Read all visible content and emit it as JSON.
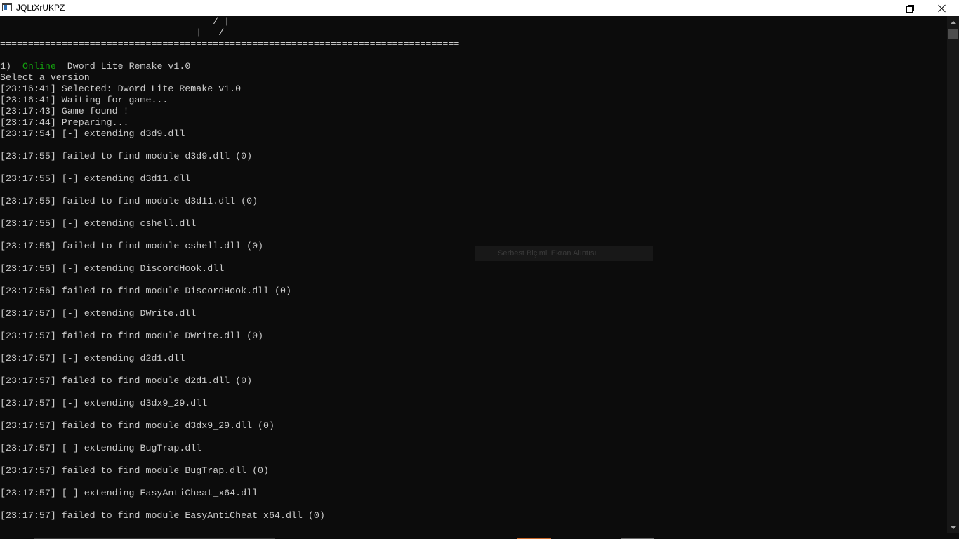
{
  "window": {
    "title": "JQLtXrUKPZ",
    "icon": "console-window-icon",
    "controls": {
      "minimize": "minimize-icon",
      "maximize": "restore-icon",
      "close": "close-icon"
    }
  },
  "console": {
    "ascii_art": [
      "                                    __/ |",
      "                                   |___/"
    ],
    "separator": "==================================================================================",
    "version_entry": {
      "index": "1)",
      "status": "Online",
      "status_color": "#13a10e",
      "name": "Dword Lite Remake v1.0"
    },
    "prompt": "Select a version",
    "log_lines": [
      "[23:16:41] Selected: Dword Lite Remake v1.0",
      "[23:16:41] Waiting for game...",
      "[23:17:43] Game found !",
      "[23:17:44] Preparing...",
      "[23:17:54] [-] extending d3d9.dll",
      "",
      "[23:17:55] failed to find module d3d9.dll (0)",
      "",
      "[23:17:55] [-] extending d3d11.dll",
      "",
      "[23:17:55] failed to find module d3d11.dll (0)",
      "",
      "[23:17:55] [-] extending cshell.dll",
      "",
      "[23:17:56] failed to find module cshell.dll (0)",
      "",
      "[23:17:56] [-] extending DiscordHook.dll",
      "",
      "[23:17:56] failed to find module DiscordHook.dll (0)",
      "",
      "[23:17:57] [-] extending DWrite.dll",
      "",
      "[23:17:57] failed to find module DWrite.dll (0)",
      "",
      "[23:17:57] [-] extending d2d1.dll",
      "",
      "[23:17:57] failed to find module d2d1.dll (0)",
      "",
      "[23:17:57] [-] extending d3dx9_29.dll",
      "",
      "[23:17:57] failed to find module d3dx9_29.dll (0)",
      "",
      "[23:17:57] [-] extending BugTrap.dll",
      "",
      "[23:17:57] failed to find module BugTrap.dll (0)",
      "",
      "[23:17:57] [-] extending EasyAntiCheat_x64.dll",
      "",
      "[23:17:57] failed to find module EasyAntiCheat_x64.dll (0)"
    ]
  },
  "overlay": {
    "label": "Serbest Biçimli Ekran Alıntısı"
  },
  "colors": {
    "console_bg": "#0c0c0c",
    "console_text": "#cccccc",
    "titlebar_bg": "#ffffff"
  }
}
